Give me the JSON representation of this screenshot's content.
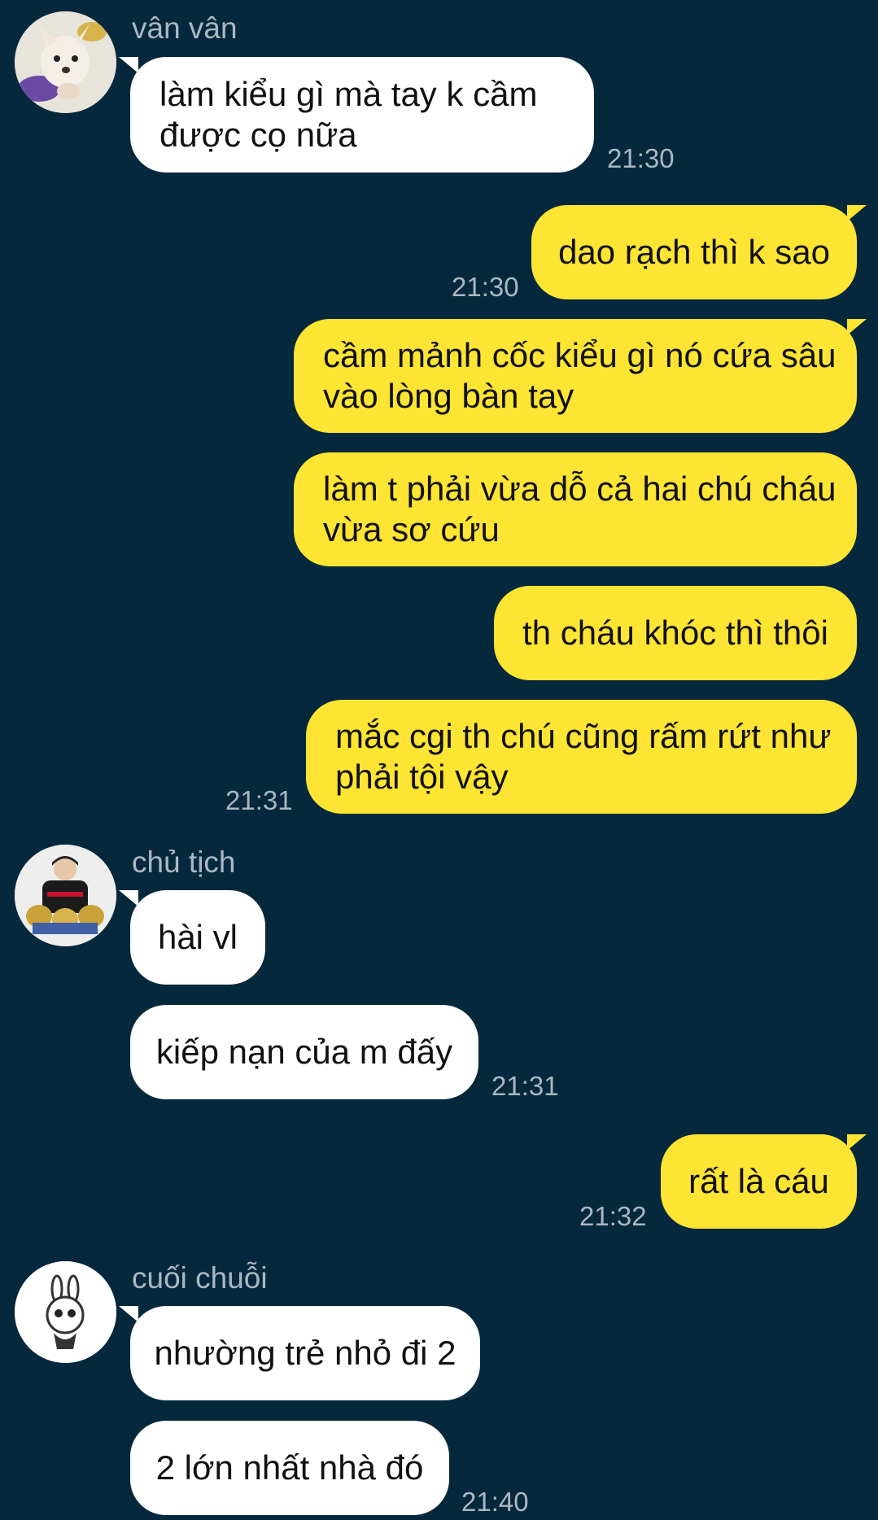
{
  "messages": [
    {
      "sender": "vân vân",
      "text_line1": "làm kiểu gì mà tay k cầm",
      "text_line2": "được cọ nữa",
      "time": "21:30"
    },
    {
      "text": "dao rạch thì k sao",
      "time": "21:30"
    },
    {
      "text_line1": "cầm mảnh cốc kiểu gì nó cứa sâu",
      "text_line2": "vào lòng bàn tay"
    },
    {
      "text_line1": "làm t phải vừa dỗ cả hai chú cháu",
      "text_line2": "vừa sơ cứu"
    },
    {
      "text": "th cháu khóc thì thôi"
    },
    {
      "text_line1": "mắc cgi th chú cũng rấm rứt như",
      "text_line2": "phải tội vậy",
      "time": "21:31"
    },
    {
      "sender": "chủ tịch",
      "text": "hài vl"
    },
    {
      "text": "kiếp nạn của m đấy",
      "time": "21:31"
    },
    {
      "text": "rất là cáu",
      "time": "21:32"
    },
    {
      "sender": "cuối chuỗi",
      "text": "nhường trẻ nhỏ đi 2"
    },
    {
      "text": "2 lớn nhất nhà đó",
      "time": "21:40"
    }
  ]
}
